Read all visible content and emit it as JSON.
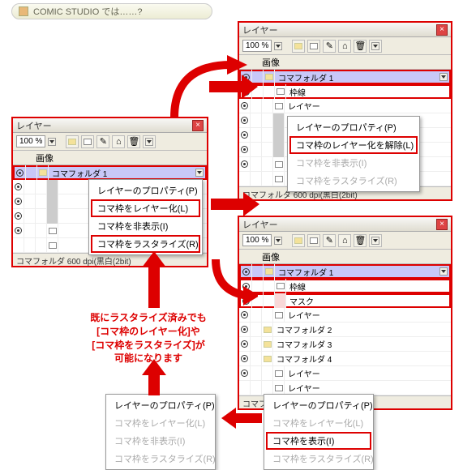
{
  "tag": "COMIC STUDIO では……?",
  "panel": {
    "title": "レイヤー",
    "zoom": "100 %",
    "header": "画像",
    "folder": "コマフォルダ 1",
    "layer": "レイヤー",
    "waku": "枠線",
    "mask": "マスク",
    "f2": "コマフォルダ 2",
    "f3": "コマフォルダ 3",
    "f4": "コマフォルダ 4",
    "foot": "コマフォルダ 600 dpi(黒白(2bit)"
  },
  "menu1": {
    "i1": "レイヤーのプロパティ(P)",
    "i2": "コマ枠をレイヤー化(L)",
    "i3": "コマ枠を非表示(I)",
    "i4": "コマ枠をラスタライズ(R)"
  },
  "menu2": {
    "i1": "レイヤーのプロパティ(P)",
    "i2": "コマ枠のレイヤー化を解除(L)",
    "i3": "コマ枠を非表示(I)",
    "i4": "コマ枠をラスタライズ(R)"
  },
  "menu3": {
    "i1": "レイヤーのプロパティ(P)",
    "i2": "コマ枠をレイヤー化(L)",
    "i3": "コマ枠を非表示(I)",
    "i4": "コマ枠をラスタライズ(R)"
  },
  "menu4": {
    "i1": "レイヤーのプロパティ(P)",
    "i2": "コマ枠をレイヤー化(L)",
    "i3": "コマ枠を表示(I)",
    "i4": "コマ枠をラスタライズ(R)"
  },
  "caption": "既にラスタライズ済みでも\n[コマ枠のレイヤー化]や\n[コマ枠をラスタライズ]が\n可能になります"
}
